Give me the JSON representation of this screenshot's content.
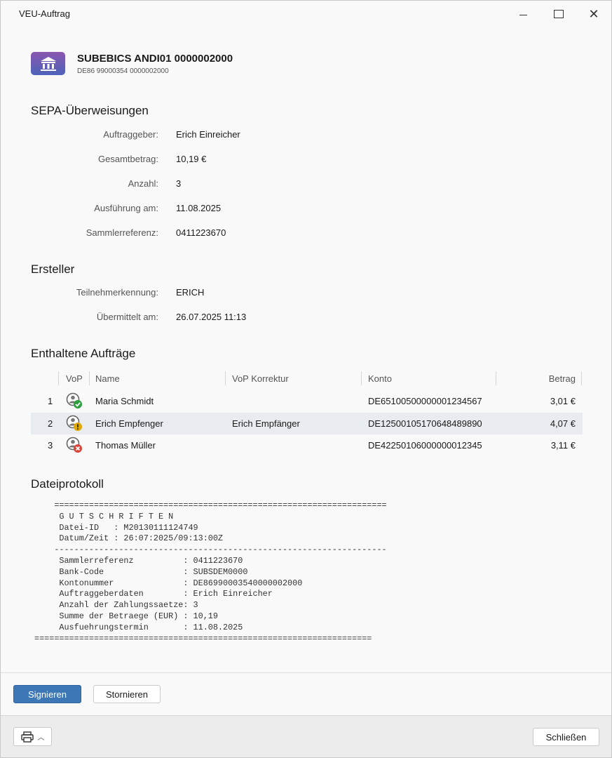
{
  "window": {
    "title": "VEU-Auftrag"
  },
  "account": {
    "name": "SUBEBICS ANDI01 0000002000",
    "iban": "DE86 99000354 0000002000",
    "icon": "bank-icon"
  },
  "sepa": {
    "title": "SEPA-Überweisungen",
    "rows": [
      {
        "label": "Auftraggeber:",
        "value": "Erich Einreicher"
      },
      {
        "label": "Gesamtbetrag:",
        "value": "10,19 €"
      },
      {
        "label": "Anzahl:",
        "value": "3"
      },
      {
        "label": "Ausführung am:",
        "value": "11.08.2025"
      },
      {
        "label": "Sammlerreferenz:",
        "value": "0411223670"
      }
    ]
  },
  "creator": {
    "title": "Ersteller",
    "rows": [
      {
        "label": "Teilnehmerkennung:",
        "value": "ERICH"
      },
      {
        "label": "Übermittelt am:",
        "value": "26.07.2025 11:13"
      }
    ]
  },
  "orders": {
    "title": "Enthaltene Aufträge",
    "columns": {
      "vop": "VoP",
      "name": "Name",
      "correction": "VoP Korrektur",
      "account": "Konto",
      "amount": "Betrag"
    },
    "rows": [
      {
        "index": "1",
        "status": "check",
        "name": "Maria Schmidt",
        "correction": "",
        "account": "DE65100500000001234567",
        "amount": "3,01 €"
      },
      {
        "index": "2",
        "status": "warning",
        "name": "Erich Empfenger",
        "correction": "Erich Empfänger",
        "account": "DE12500105170648489890",
        "amount": "4,07 €"
      },
      {
        "index": "3",
        "status": "error",
        "name": "Thomas Müller",
        "correction": "",
        "account": "DE42250106000000012345",
        "amount": "3,11 €"
      }
    ],
    "status_colors": {
      "check": "#2e9e3e",
      "warning": "#e0a800",
      "error": "#d9453a"
    }
  },
  "log": {
    "title": "Dateiprotokoll",
    "lines": [
      "    ===================================================================",
      "     G U T S C H R I F T E N",
      "     Datei-ID   : M20130111124749",
      "     Datum/Zeit : 26:07:2025/09:13:00Z",
      "    -------------------------------------------------------------------",
      "     Sammlerreferenz          : 0411223670",
      "     Bank-Code                : SUBSDEM0000",
      "     Kontonummer              : DE86990003540000002000",
      "     Auftraggeberdaten        : Erich Einreicher",
      "     Anzahl der Zahlungssaetze: 3",
      "     Summe der Betraege (EUR) : 10,19",
      "     Ausfuehrungstermin       : 11.08.2025",
      "===================================================================="
    ]
  },
  "actions": {
    "sign": "Signieren",
    "cancel": "Stornieren",
    "close": "Schließen"
  },
  "colors": {
    "primary": "#3d77b5",
    "selected_row": "#e8ecf1"
  }
}
